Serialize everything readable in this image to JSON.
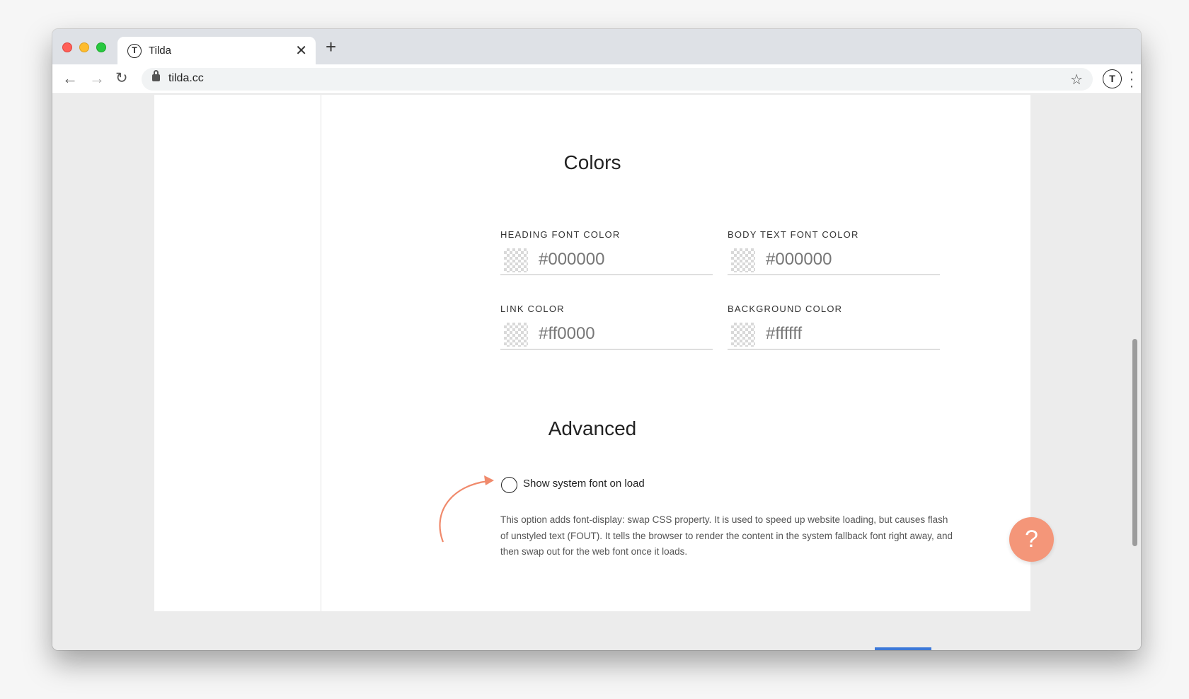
{
  "browser": {
    "tab_title": "Tilda",
    "tab_favicon": "T",
    "tab_close": "✕",
    "new_tab": "+",
    "url": "tilda.cc",
    "profile_initial": "T"
  },
  "colors_section": {
    "title": "Colors",
    "fields": [
      {
        "label": "HEADING FONT COLOR",
        "value": "#000000"
      },
      {
        "label": "BODY TEXT FONT COLOR",
        "value": "#000000"
      },
      {
        "label": "LINK COLOR",
        "value": "#ff0000"
      },
      {
        "label": "BACKGROUND COLOR",
        "value": "#ffffff"
      }
    ]
  },
  "advanced_section": {
    "title": "Advanced",
    "option_label": "Show system font on load",
    "option_checked": false,
    "description": "This option adds font-display: swap CSS property. It is used to speed up website loading, but causes flash of unstyled text (FOUT). It tells the browser to render the content in the system fallback font right away, and then swap out for the web font once it loads."
  },
  "help_button": {
    "label": "?",
    "color": "#f49679"
  },
  "accent_colors": {
    "arrow": "#f08a6c",
    "window_red": "#ff5f57",
    "window_yellow": "#febc2e",
    "window_green": "#28c840"
  },
  "icons": [
    "back-arrow-icon",
    "forward-arrow-icon",
    "reload-icon",
    "lock-icon",
    "star-icon",
    "menu-dots-icon",
    "curved-arrow-icon"
  ]
}
